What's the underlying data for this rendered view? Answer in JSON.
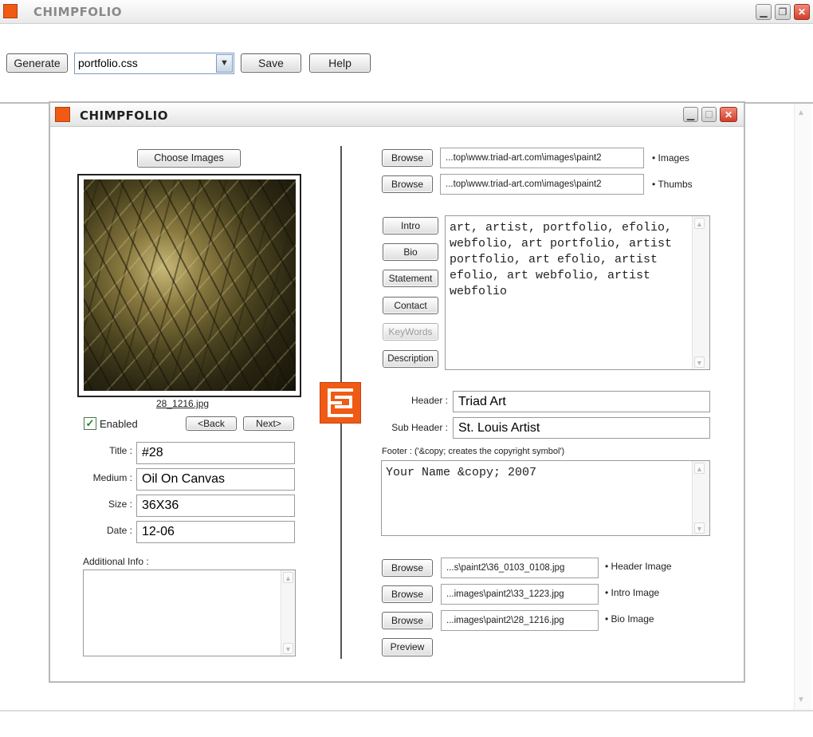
{
  "app": {
    "title": "CHIMPFOLIO",
    "toolbar": {
      "generate_label": "Generate",
      "css_select_value": "portfolio.css",
      "save_label": "Save",
      "help_label": "Help"
    }
  },
  "dialog": {
    "title": "CHIMPFOLIO",
    "left": {
      "choose_images_label": "Choose Images",
      "image_filename": "28_1216.jpg",
      "enabled_label": "Enabled",
      "enabled_checked": true,
      "back_label": "<Back",
      "next_label": "Next>",
      "fields": {
        "title_label": "Title :",
        "title_value": "#28",
        "medium_label": "Medium :",
        "medium_value": "Oil On Canvas",
        "size_label": "Size :",
        "size_value": "36X36",
        "date_label": "Date :",
        "date_value": "12-06"
      },
      "additional_info_label": "Additional Info :",
      "additional_info_value": ""
    },
    "right": {
      "paths": [
        {
          "button": "Browse",
          "value": "...top\\www.triad-art.com\\images\\paint2",
          "label": "• Images"
        },
        {
          "button": "Browse",
          "value": "...top\\www.triad-art.com\\images\\paint2",
          "label": "• Thumbs"
        }
      ],
      "section_buttons": [
        {
          "label": "Intro",
          "disabled": false
        },
        {
          "label": "Bio",
          "disabled": false
        },
        {
          "label": "Statement",
          "disabled": false
        },
        {
          "label": "Contact",
          "disabled": false
        },
        {
          "label": "KeyWords",
          "disabled": true
        },
        {
          "label": "Description",
          "disabled": false
        }
      ],
      "content_text": "art, artist, portfolio, efolio,\nwebfolio, art portfolio, artist\nportfolio, art efolio, artist\nefolio, art webfolio, artist\nwebfolio",
      "header_label": "Header :",
      "header_value": "Triad Art",
      "subheader_label": "Sub Header :",
      "subheader_value": "St. Louis Artist",
      "footer_label": "Footer : ('&copy; creates the copyright symbol')",
      "footer_value": "Your Name &copy; 2007",
      "image_paths": [
        {
          "button": "Browse",
          "value": "...s\\paint2\\36_0103_0108.jpg",
          "label": "• Header Image"
        },
        {
          "button": "Browse",
          "value": "...images\\paint2\\33_1223.jpg",
          "label": "• Intro Image"
        },
        {
          "button": "Browse",
          "value": "...images\\paint2\\28_1216.jpg",
          "label": "• Bio Image"
        }
      ],
      "preview_label": "Preview"
    }
  },
  "icons": {
    "app_icon": "orange-square-icon",
    "logo": "chimpfolio-e-logo",
    "accent_color": "#f05a14"
  }
}
